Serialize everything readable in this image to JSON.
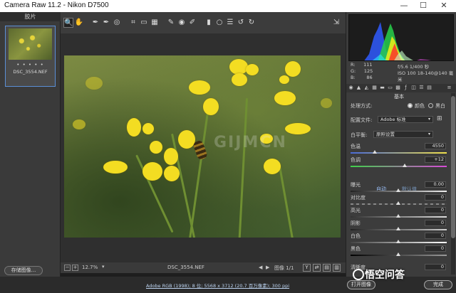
{
  "window": {
    "title": "Camera Raw 11.2  -  Nikon D7500",
    "minimize": "—",
    "maximize": "☐",
    "close": "✕"
  },
  "filmstrip": {
    "header": "胶片",
    "thumb_rating": "• • • • •",
    "thumb_name": "DSC_3554.NEF",
    "save_button": "存储图像..."
  },
  "toolbar": {
    "tools": [
      {
        "name": "zoom-tool-icon",
        "glyph": "🔍"
      },
      {
        "name": "hand-tool-icon",
        "glyph": "✋"
      },
      {
        "name": "white-balance-tool-icon",
        "glyph": "✒"
      },
      {
        "name": "color-sampler-tool-icon",
        "glyph": "✒"
      },
      {
        "name": "targeted-adjustment-tool-icon",
        "glyph": "◎"
      },
      {
        "name": "crop-tool-icon",
        "glyph": "⌗"
      },
      {
        "name": "straighten-tool-icon",
        "glyph": "▭"
      },
      {
        "name": "transform-tool-icon",
        "glyph": "▦"
      },
      {
        "name": "spot-removal-tool-icon",
        "glyph": "✎"
      },
      {
        "name": "red-eye-tool-icon",
        "glyph": "◉"
      },
      {
        "name": "adjustment-brush-icon",
        "glyph": "✐"
      },
      {
        "name": "graduated-filter-icon",
        "glyph": "▮"
      },
      {
        "name": "radial-filter-icon",
        "glyph": "○"
      },
      {
        "name": "preferences-icon",
        "glyph": "☰"
      },
      {
        "name": "rotate-left-icon",
        "glyph": "↺"
      },
      {
        "name": "rotate-right-icon",
        "glyph": "↻"
      }
    ],
    "export_glyph": "⇲"
  },
  "canvas": {
    "watermark": "GIJMCN",
    "zoom_minus": "−",
    "zoom_plus": "+",
    "zoom_value": "12.7%",
    "zoom_arrow": "▾",
    "file_name": "DSC_3554.NEF",
    "nav_prev": "◀",
    "nav_next": "▶",
    "image_count": "图像 1/1",
    "before_after": "Y"
  },
  "histogram": {
    "r_label": "R:",
    "r_value": "111",
    "g_label": "G:",
    "g_value": "125",
    "b_label": "B:",
    "b_value": "86",
    "aperture_shutter": "f/5.6  1/400 秒",
    "iso_lens": "ISO 100  18-140@140 毫米"
  },
  "panel": {
    "section_title": "基本",
    "treatment_label": "处理方式:",
    "treatment_color": "颜色",
    "treatment_bw": "黑白",
    "profile_label": "配置文件:",
    "profile_value": "Adobe 标准",
    "wb_label": "白平衡:",
    "wb_value": "原照设置",
    "temperature_label": "色温",
    "temperature_value": "4550",
    "tint_label": "色调",
    "tint_value": "+12",
    "auto_link": "自动",
    "default_link": "默认值",
    "exposure_label": "曝光",
    "exposure_value": "0.00",
    "contrast_label": "对比度",
    "contrast_value": "0",
    "highlights_label": "高光",
    "highlights_value": "0",
    "shadows_label": "阴影",
    "shadows_value": "0",
    "whites_label": "白色",
    "whites_value": "0",
    "blacks_label": "黑色",
    "blacks_value": "0",
    "clarity_label": "清晰度",
    "clarity_value": "0"
  },
  "footer": {
    "workflow_link": "Adobe RGB (1998); 8 位; 5568 x 3712 (20.7 百万像素); 300 ppi",
    "open_button": "打开图像",
    "done_button": "完成",
    "brand_text": "悟空问答"
  },
  "colors": {
    "accent": "#5b8fd6",
    "flower": "#f3dd22"
  }
}
